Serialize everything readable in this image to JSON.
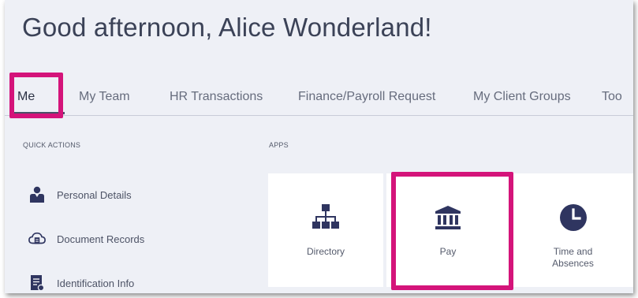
{
  "greeting": "Good afternoon, Alice Wonderland!",
  "tabs": [
    {
      "label": "Me",
      "active": true
    },
    {
      "label": "My Team"
    },
    {
      "label": "HR Transactions"
    },
    {
      "label": "Finance/Payroll Request"
    },
    {
      "label": "My Client Groups"
    },
    {
      "label": "Too"
    }
  ],
  "quick_actions": {
    "heading": "QUICK ACTIONS",
    "items": [
      {
        "label": "Personal Details",
        "icon": "person-icon"
      },
      {
        "label": "Document Records",
        "icon": "cloud-document-icon"
      },
      {
        "label": "Identification Info",
        "icon": "id-card-icon"
      }
    ]
  },
  "apps": {
    "heading": "APPS",
    "tiles": [
      {
        "label": "Directory",
        "icon": "org-chart-icon"
      },
      {
        "label": "Pay",
        "icon": "bank-icon"
      },
      {
        "label": "Time and Absences",
        "icon": "clock-icon"
      }
    ]
  },
  "colors": {
    "highlight": "#d4147a",
    "icon": "#2f3560",
    "background": "#eef0f6",
    "tile": "#ffffff"
  }
}
